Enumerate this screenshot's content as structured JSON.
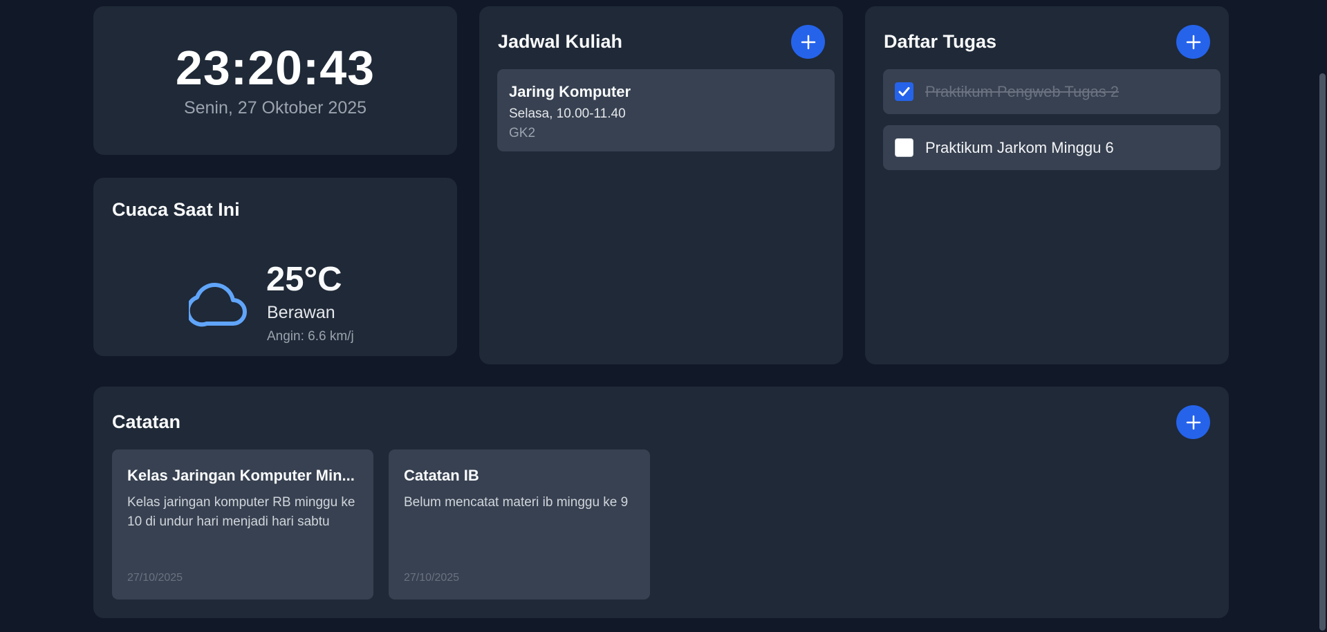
{
  "clock": {
    "time": "23:20:43",
    "date": "Senin, 27 Oktober 2025"
  },
  "weather": {
    "title": "Cuaca Saat Ini",
    "icon": "cloud-icon",
    "temperature": "25°C",
    "condition": "Berawan",
    "wind": "Angin: 6.6 km/j"
  },
  "schedule": {
    "title": "Jadwal Kuliah",
    "items": [
      {
        "course": "Jaring Komputer",
        "time": "Selasa, 10.00-11.40",
        "room": "GK2"
      }
    ]
  },
  "tasks": {
    "title": "Daftar Tugas",
    "items": [
      {
        "label": "Praktikum Pengweb Tugas 2",
        "done": true
      },
      {
        "label": "Praktikum Jarkom Minggu 6",
        "done": false
      }
    ]
  },
  "notes": {
    "title": "Catatan",
    "items": [
      {
        "title": "Kelas Jaringan Komputer Min...",
        "body": "Kelas jaringan komputer RB minggu ke 10 di undur hari menjadi hari sabtu",
        "date": "27/10/2025"
      },
      {
        "title": "Catatan IB",
        "body": "Belum mencatat materi ib minggu ke 9",
        "date": "27/10/2025"
      }
    ]
  },
  "colors": {
    "background": "#111827",
    "card": "#1f2937",
    "item": "#374151",
    "accent": "#2563eb",
    "weather_icon": "#60a5fa"
  }
}
